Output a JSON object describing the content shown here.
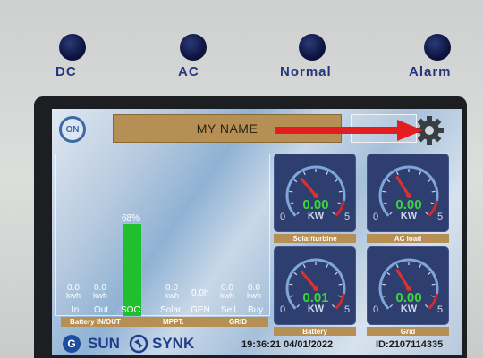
{
  "indicators": [
    {
      "label": "DC"
    },
    {
      "label": "AC"
    },
    {
      "label": "Normal"
    },
    {
      "label": "Alarm"
    }
  ],
  "header": {
    "on_label": "ON",
    "name": "MY NAME"
  },
  "soc": {
    "percent_label": "68%",
    "percent": 68
  },
  "readings": [
    {
      "value": "0.0",
      "unit": "kwh",
      "label": "In"
    },
    {
      "value": "0.0",
      "unit": "kwh",
      "label": "Out"
    },
    {
      "value": "",
      "unit": "",
      "label": "SOC"
    },
    {
      "value": "0.0",
      "unit": "kwh",
      "label": "Solar"
    },
    {
      "value": "0.0h",
      "unit": "",
      "label": "GEN"
    },
    {
      "value": "0.0",
      "unit": "kwh",
      "label": "Sell"
    },
    {
      "value": "0.0",
      "unit": "kwh",
      "label": "Buy"
    }
  ],
  "sections": {
    "battery": "Battery IN/OUT",
    "mppt": "MPPT.",
    "grid": "GRID"
  },
  "gauges": [
    {
      "value": "0.00",
      "unit": "KW",
      "min": "0",
      "max": "5",
      "label": "Solar/turbine",
      "needle_fraction": 0.35
    },
    {
      "value": "0.00",
      "unit": "KW",
      "min": "0",
      "max": "5",
      "label": "AC load",
      "needle_fraction": 0.38
    },
    {
      "value": "0.01",
      "unit": "KW",
      "min": "0",
      "max": "5",
      "label": "Battery",
      "needle_fraction": 0.35
    },
    {
      "value": "0.00",
      "unit": "KW",
      "min": "0",
      "max": "5",
      "label": "Grid",
      "needle_fraction": 0.38
    }
  ],
  "footer": {
    "logo_letter": "G",
    "brand_left": "SUN",
    "brand_right": "SYNK",
    "datetime": "19:36:21 04/01/2022",
    "device_id": "ID:2107114335"
  },
  "colors": {
    "accent_gold": "#b58f53",
    "soc_green": "#1fbf2f",
    "gauge_value": "#3cd63c",
    "arrow_red": "#e41e1e"
  }
}
